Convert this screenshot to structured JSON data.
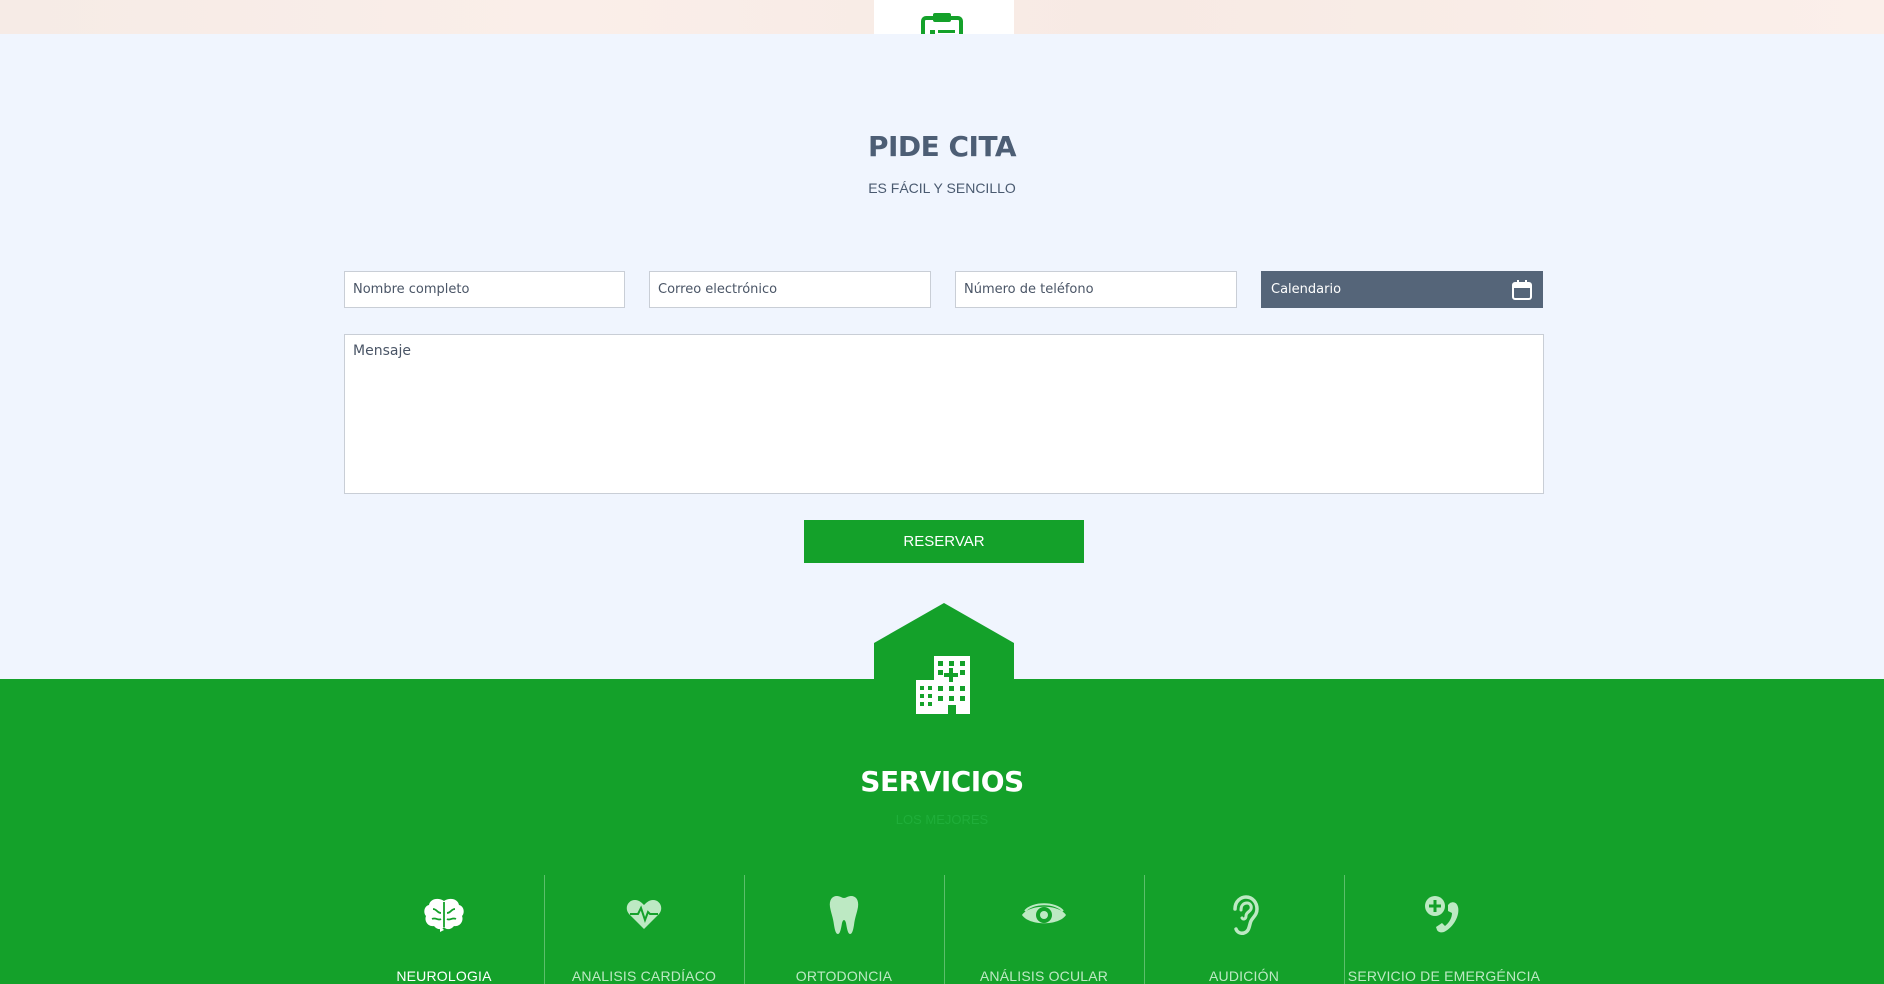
{
  "appointment": {
    "title": "PIDE CITA",
    "subtitle": "ES FÁCIL Y SENCILLO",
    "name_placeholder": "Nombre completo",
    "email_placeholder": "Correo electrónico",
    "phone_placeholder": "Número de teléfono",
    "calendar_label": "Calendario",
    "message_placeholder": "Mensaje",
    "submit_label": "RESERVAR"
  },
  "services": {
    "title": "SERVICIOS",
    "subtitle": "LOS MEJORES",
    "items": [
      {
        "label": "NEUROLOGIA",
        "icon": "brain-icon",
        "active": true
      },
      {
        "label": "ANALISIS CARDÍACO",
        "icon": "heart-pulse-icon",
        "active": false
      },
      {
        "label": "ORTODONCIA",
        "icon": "tooth-icon",
        "active": false
      },
      {
        "label": "ANÁLISIS OCULAR",
        "icon": "eye-icon",
        "active": false
      },
      {
        "label": "AUDICIÓN",
        "icon": "ear-icon",
        "active": false
      },
      {
        "label": "SERVICIO DE EMERGÉNCIA",
        "icon": "emergency-phone-icon",
        "active": false
      }
    ]
  },
  "colors": {
    "brand_green": "#14a12a",
    "slate": "#556579",
    "page_bg": "#f0f5fe"
  }
}
